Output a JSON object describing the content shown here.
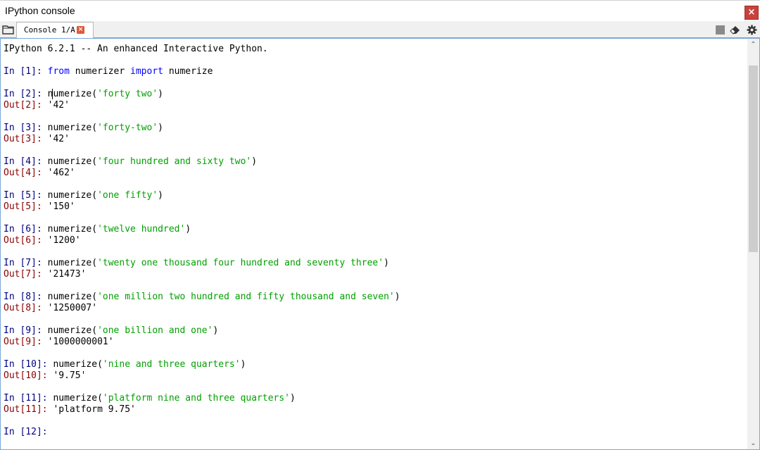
{
  "window": {
    "title": "IPython console",
    "close_label": "×"
  },
  "tabbar": {
    "tab_label": "Console 1/A",
    "tab_close_label": "×",
    "icons": [
      "folder-icon",
      "stop-icon",
      "eraser-icon",
      "gear-icon"
    ]
  },
  "console": {
    "banner": "IPython 6.2.1 -- An enhanced Interactive Python.",
    "cells": [
      {
        "in_prompt": "In [1]: ",
        "code": [
          [
            "kw",
            "from"
          ],
          [
            "plain",
            " numerizer "
          ],
          [
            "kw",
            "import"
          ],
          [
            "plain",
            " numerize"
          ]
        ],
        "out_prompt": null,
        "out": null
      },
      {
        "in_prompt": "In [2]: ",
        "code": [
          [
            "plain",
            "n"
          ],
          [
            "caret",
            "umerize("
          ],
          [
            "str",
            "'forty two'"
          ],
          [
            "plain",
            ")"
          ]
        ],
        "out_prompt": "Out[2]: ",
        "out": "'42'"
      },
      {
        "in_prompt": "In [3]: ",
        "code": [
          [
            "plain",
            "numerize("
          ],
          [
            "str",
            "'forty-two'"
          ],
          [
            "plain",
            ")"
          ]
        ],
        "out_prompt": "Out[3]: ",
        "out": "'42'"
      },
      {
        "in_prompt": "In [4]: ",
        "code": [
          [
            "plain",
            "numerize("
          ],
          [
            "str",
            "'four hundred and sixty two'"
          ],
          [
            "plain",
            ")"
          ]
        ],
        "out_prompt": "Out[4]: ",
        "out": "'462'"
      },
      {
        "in_prompt": "In [5]: ",
        "code": [
          [
            "plain",
            "numerize("
          ],
          [
            "str",
            "'one fifty'"
          ],
          [
            "plain",
            ")"
          ]
        ],
        "out_prompt": "Out[5]: ",
        "out": "'150'"
      },
      {
        "in_prompt": "In [6]: ",
        "code": [
          [
            "plain",
            "numerize("
          ],
          [
            "str",
            "'twelve hundred'"
          ],
          [
            "plain",
            ")"
          ]
        ],
        "out_prompt": "Out[6]: ",
        "out": "'1200'"
      },
      {
        "in_prompt": "In [7]: ",
        "code": [
          [
            "plain",
            "numerize("
          ],
          [
            "str",
            "'twenty one thousand four hundred and seventy three'"
          ],
          [
            "plain",
            ")"
          ]
        ],
        "out_prompt": "Out[7]: ",
        "out": "'21473'"
      },
      {
        "in_prompt": "In [8]: ",
        "code": [
          [
            "plain",
            "numerize("
          ],
          [
            "str",
            "'one million two hundred and fifty thousand and seven'"
          ],
          [
            "plain",
            ")"
          ]
        ],
        "out_prompt": "Out[8]: ",
        "out": "'1250007'"
      },
      {
        "in_prompt": "In [9]: ",
        "code": [
          [
            "plain",
            "numerize("
          ],
          [
            "str",
            "'one billion and one'"
          ],
          [
            "plain",
            ")"
          ]
        ],
        "out_prompt": "Out[9]: ",
        "out": "'1000000001'"
      },
      {
        "in_prompt": "In [10]: ",
        "code": [
          [
            "plain",
            "numerize("
          ],
          [
            "str",
            "'nine and three quarters'"
          ],
          [
            "plain",
            ")"
          ]
        ],
        "out_prompt": "Out[10]: ",
        "out": "'9.75'"
      },
      {
        "in_prompt": "In [11]: ",
        "code": [
          [
            "plain",
            "numerize("
          ],
          [
            "str",
            "'platform nine and three quarters'"
          ],
          [
            "plain",
            ")"
          ]
        ],
        "out_prompt": "Out[11]: ",
        "out": "'platform 9.75'"
      },
      {
        "in_prompt": "In [12]: ",
        "code": [],
        "out_prompt": null,
        "out": null
      }
    ]
  },
  "scrollbar": {
    "up_arrow": "⌃",
    "down_arrow": "⌄"
  },
  "colors": {
    "in_prompt": "#000080",
    "out_prompt": "#8b0000",
    "keyword": "#0000ff",
    "string": "#00a000",
    "close_button": "#c9413d"
  }
}
